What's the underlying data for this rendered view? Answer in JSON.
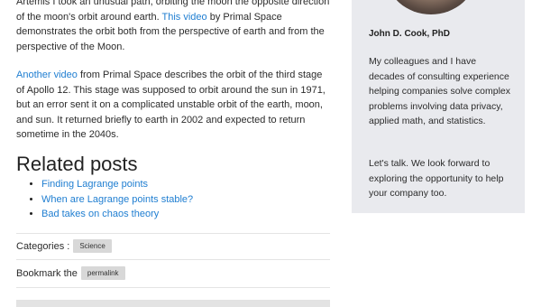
{
  "article": {
    "p1": {
      "text_before": "Artemis I took an unusual path, orbiting the moon the opposite direction of the moon's orbit around earth. ",
      "link": "This video",
      "text_after": " by Primal Space demonstrates the orbit both from the perspective of earth and from the perspective of the Moon."
    },
    "p2": {
      "link": "Another video",
      "text_after": " from Primal Space describes the orbit of the third stage of Apollo 12. This stage was supposed to orbit around the sun in 1971, but an error sent it on a complicated unstable orbit of the earth, moon, and sun. It returned briefly to earth in 2002 and expected to return sometime in the 2040s."
    }
  },
  "related": {
    "title": "Related posts",
    "items": [
      "Finding Lagrange points",
      "When are Lagrange points stable?",
      "Bad takes on chaos theory"
    ]
  },
  "meta": {
    "categories_label": "Categories :",
    "category": "Science",
    "bookmark_label": "Bookmark the",
    "permalink": "permalink"
  },
  "sidebar": {
    "name": "John D. Cook, PhD",
    "bio": "My colleagues and I have decades of consulting experience helping companies solve complex problems involving data privacy, applied math, and statistics.",
    "cta": "Let's talk. We look forward to exploring the opportunity to help your company too."
  },
  "colors": {
    "link": "#1f7ed1",
    "sidebar_bg": "#e9eaee",
    "tag_bg": "#d8d8d8"
  }
}
